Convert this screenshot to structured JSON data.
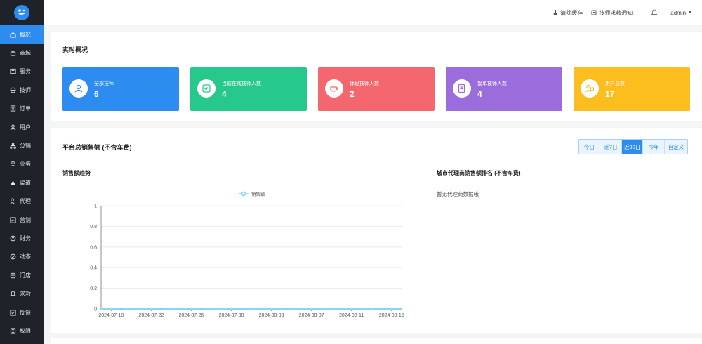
{
  "header": {
    "clear_cache": "清除缓存",
    "tech_help": "技师求救通知",
    "user": "admin"
  },
  "sidebar": {
    "items": [
      {
        "label": "概况",
        "icon": "home-icon"
      },
      {
        "label": "商城",
        "icon": "shop-icon"
      },
      {
        "label": "服务",
        "icon": "service-icon"
      },
      {
        "label": "技师",
        "icon": "technician-icon"
      },
      {
        "label": "订单",
        "icon": "order-icon"
      },
      {
        "label": "用户",
        "icon": "user-icon"
      },
      {
        "label": "分销",
        "icon": "distribution-icon"
      },
      {
        "label": "业务",
        "icon": "business-icon"
      },
      {
        "label": "渠道",
        "icon": "channel-icon"
      },
      {
        "label": "代理",
        "icon": "agent-icon"
      },
      {
        "label": "营销",
        "icon": "marketing-icon"
      },
      {
        "label": "财务",
        "icon": "finance-icon"
      },
      {
        "label": "动态",
        "icon": "dynamic-icon"
      },
      {
        "label": "门店",
        "icon": "store-icon"
      },
      {
        "label": "求救",
        "icon": "sos-icon"
      },
      {
        "label": "反馈",
        "icon": "feedback-icon"
      },
      {
        "label": "权限",
        "icon": "permission-icon"
      }
    ]
  },
  "overview": {
    "title": "实时概况",
    "cards": [
      {
        "label": "全部技师",
        "value": "6",
        "color": "#2d8cf0"
      },
      {
        "label": "当前在线技师人数",
        "value": "4",
        "color": "#26c98b"
      },
      {
        "label": "休息技师人数",
        "value": "2",
        "color": "#f5676f"
      },
      {
        "label": "接单技师人数",
        "value": "4",
        "color": "#9a6cdc"
      },
      {
        "label": "用户总数",
        "value": "17",
        "color": "#fcbd1f"
      }
    ]
  },
  "sales": {
    "title": "平台总销售额 (不含车费)",
    "ranges": [
      "今日",
      "近7日",
      "近30日",
      "今年",
      "自定义"
    ],
    "active_range": 2,
    "trend_title": "销售额趋势",
    "ranking_title": "城市代理商销售额排名 (不含车费)",
    "ranking_empty": "暂无代理商数据哦"
  },
  "chart_data": {
    "type": "line",
    "title": "",
    "xlabel": "",
    "ylabel": "",
    "x_ticks": [
      "2024-07-18",
      "2024-07-22",
      "2024-07-26",
      "2024-07-30",
      "2024-08-03",
      "2024-08-07",
      "2024-08-11",
      "2024-08-15"
    ],
    "y_ticks": [
      0,
      0.2,
      0.4,
      0.6,
      0.8,
      1
    ],
    "ylim": [
      0,
      1
    ],
    "grid": true,
    "legend": "top-center",
    "series": [
      {
        "name": "销售额",
        "color": "#5ec8f2",
        "x": [
          "2024-07-17",
          "2024-07-18",
          "2024-07-19",
          "2024-07-20",
          "2024-07-21",
          "2024-07-22",
          "2024-07-23",
          "2024-07-24",
          "2024-07-25",
          "2024-07-26",
          "2024-07-27",
          "2024-07-28",
          "2024-07-29",
          "2024-07-30",
          "2024-07-31",
          "2024-08-01",
          "2024-08-02",
          "2024-08-03",
          "2024-08-04",
          "2024-08-05",
          "2024-08-06",
          "2024-08-07",
          "2024-08-08",
          "2024-08-09",
          "2024-08-10",
          "2024-08-11",
          "2024-08-12",
          "2024-08-13",
          "2024-08-14",
          "2024-08-15",
          "2024-08-16"
        ],
        "values": [
          0,
          0,
          0,
          0,
          0,
          0,
          0,
          0,
          0,
          0,
          0,
          0,
          0,
          0,
          0,
          0,
          0,
          0,
          0,
          0,
          0,
          0,
          0,
          0,
          0,
          0,
          0,
          0,
          0,
          0,
          0
        ]
      }
    ]
  }
}
